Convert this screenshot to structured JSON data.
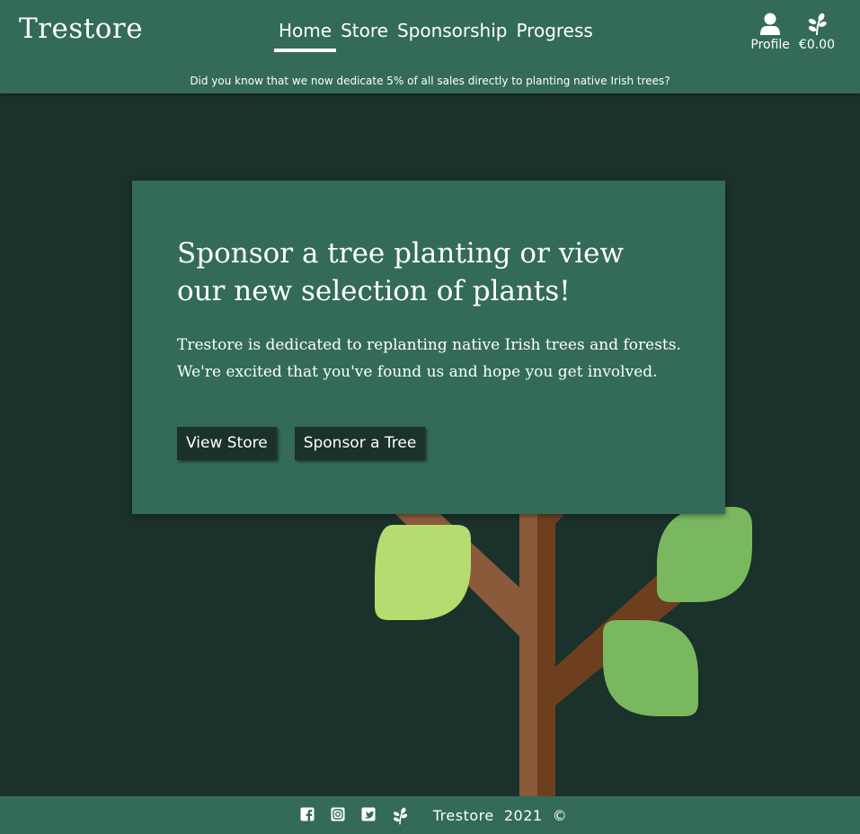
{
  "brand": "Trestore",
  "nav": {
    "items": [
      {
        "label": "Home",
        "active": true
      },
      {
        "label": "Store",
        "active": false
      },
      {
        "label": "Sponsorship",
        "active": false
      },
      {
        "label": "Progress",
        "active": false
      }
    ]
  },
  "account": {
    "profile_label": "Profile",
    "profile_icon": "user-icon",
    "cart_total": "€0.00",
    "cart_icon": "leaf-sprig-icon"
  },
  "notice": "Did you know that we now dedicate 5% of all sales directly to planting native Irish trees?",
  "hero": {
    "title": "Sponsor a tree planting or view our new selection of plants!",
    "body_line1": "Trestore is dedicated to replanting native Irish trees and forests.",
    "body_line2": "We're excited that you've found us and hope you get involved.",
    "view_store_label": "View Store",
    "sponsor_label": "Sponsor a Tree"
  },
  "footer": {
    "social_icons": [
      "facebook-icon",
      "instagram-icon",
      "twitter-icon",
      "leaf-sprig-icon"
    ],
    "copyright": "Trestore  2021  ©"
  },
  "colors": {
    "background": "#1b312b",
    "header": "#336b58",
    "trunk_dark": "#6e3f1f",
    "trunk_light": "#8b5a3b",
    "leaf_light": "#b4dc6e",
    "leaf_green": "#7ab85f"
  }
}
